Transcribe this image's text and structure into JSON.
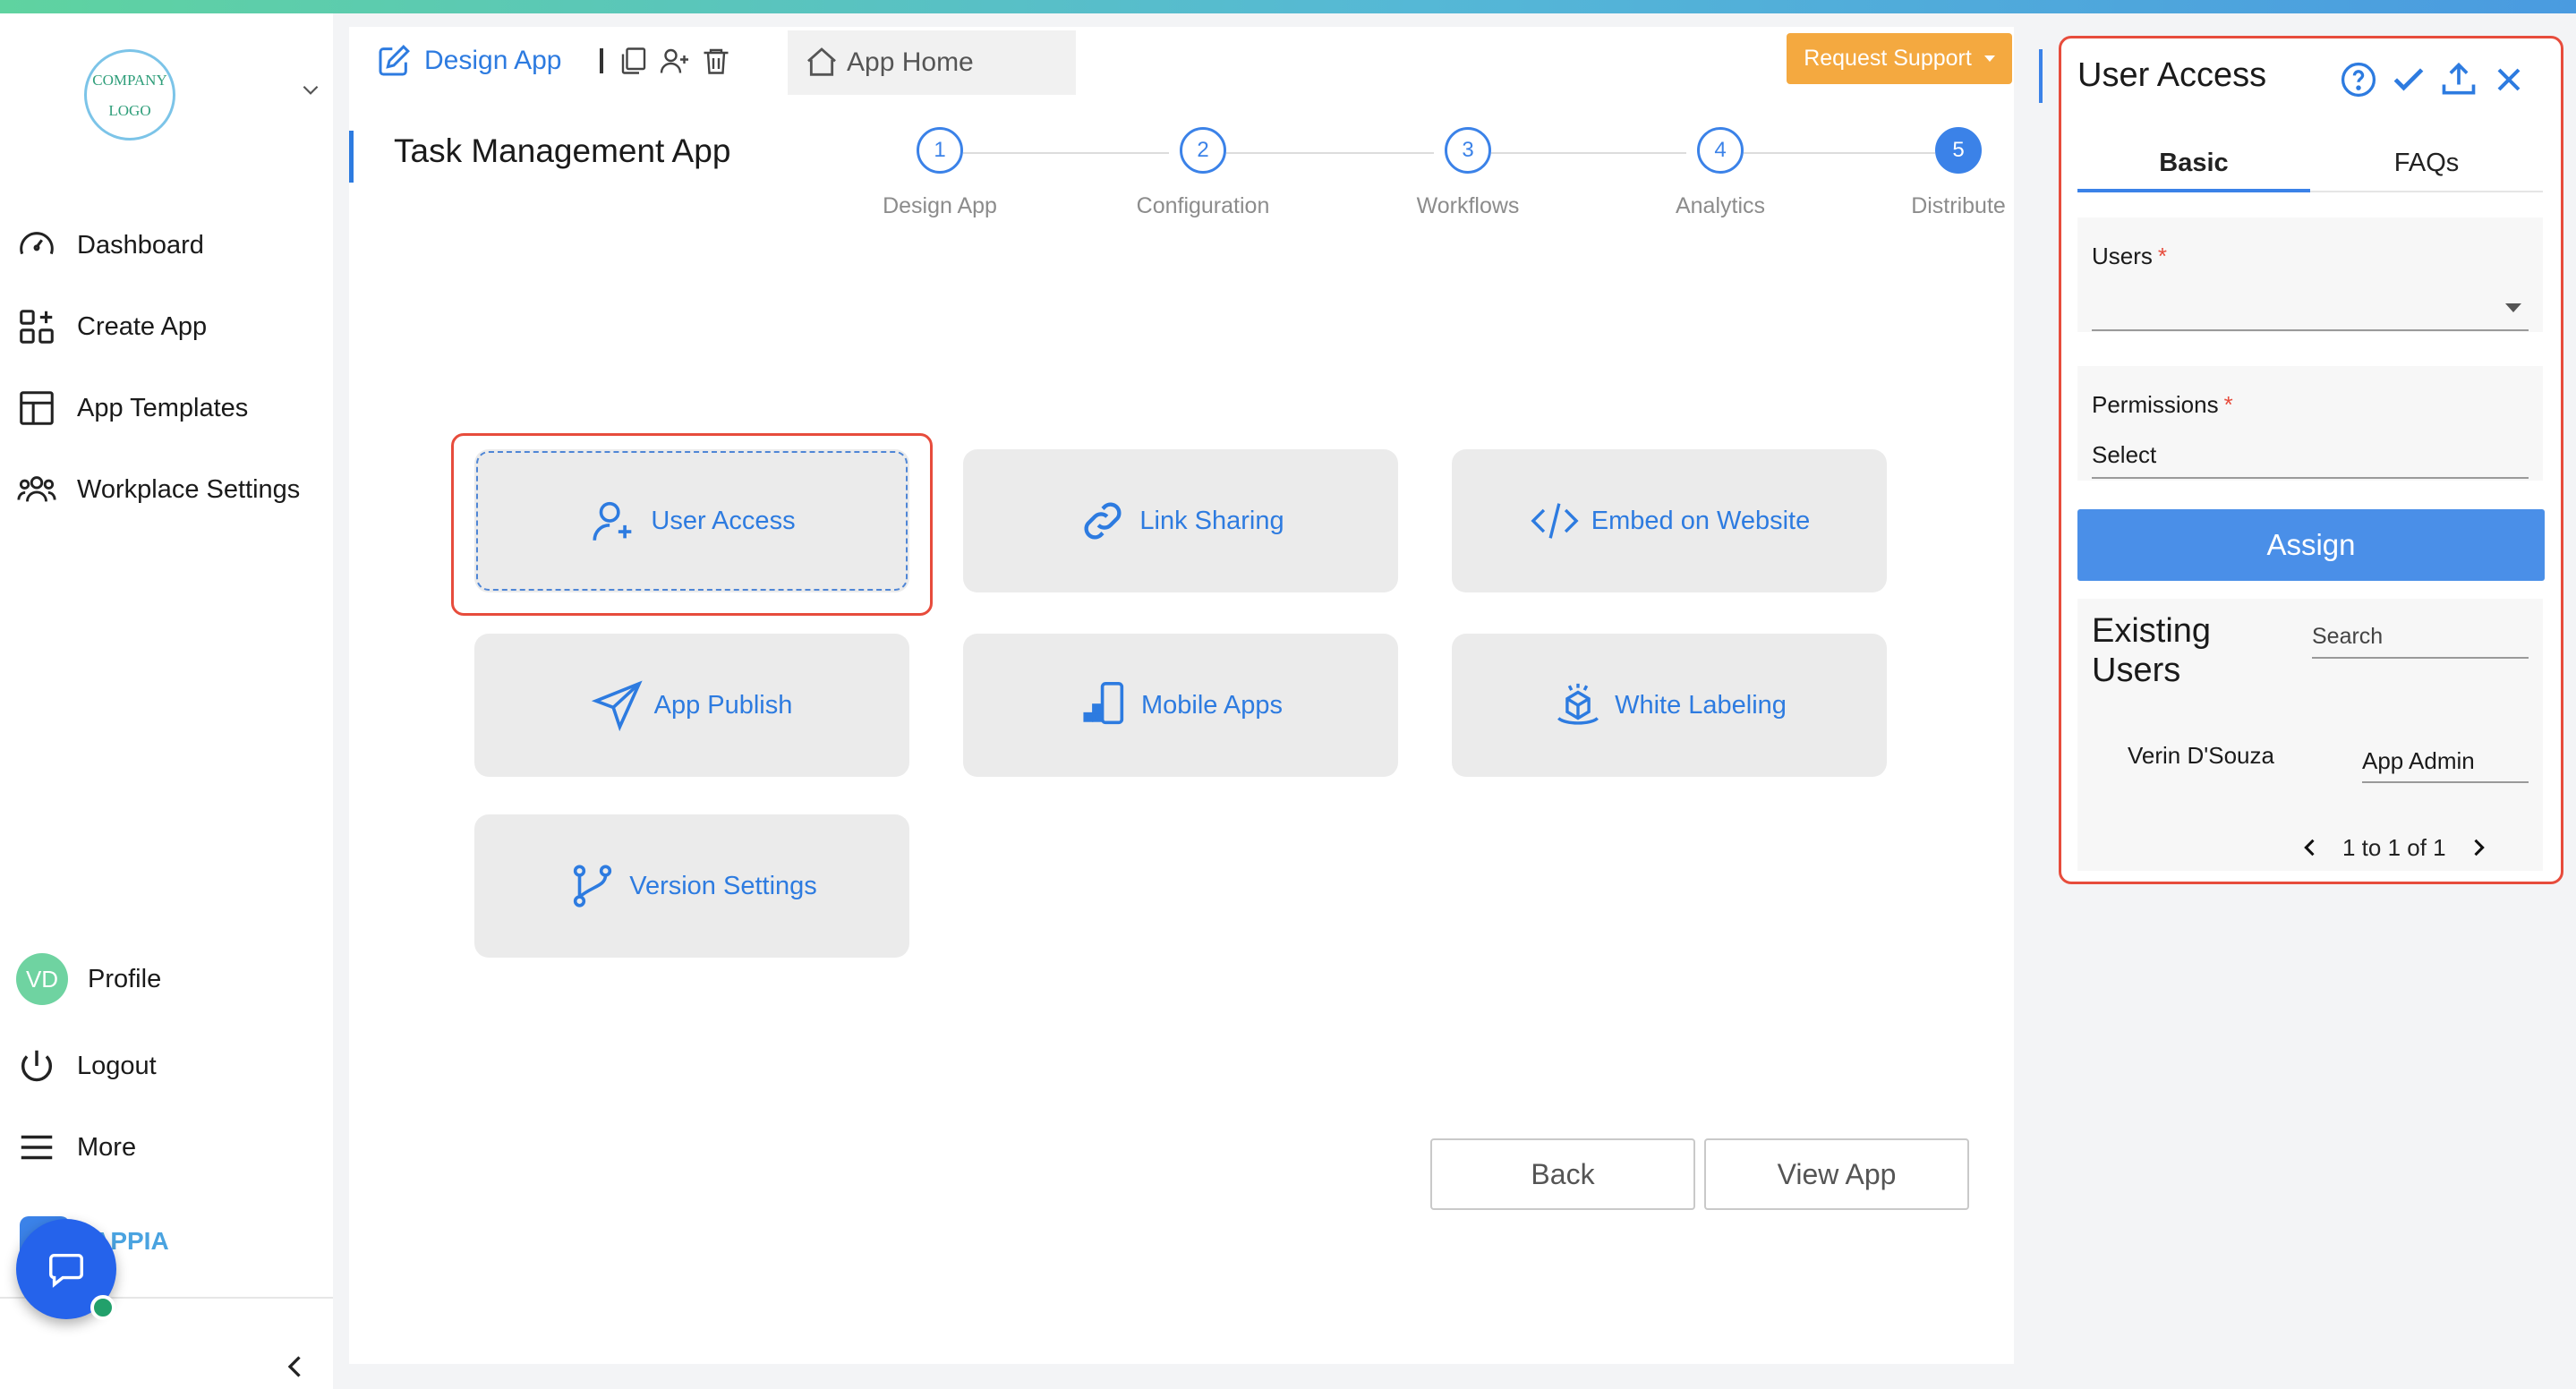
{
  "logo": {
    "line1": "COMPANY",
    "line2": "LOGO"
  },
  "sidebar": {
    "items": [
      {
        "label": "Dashboard",
        "icon": "gauge-icon"
      },
      {
        "label": "Create App",
        "icon": "grid-plus-icon"
      },
      {
        "label": "App Templates",
        "icon": "layout-icon"
      },
      {
        "label": "Workplace Settings",
        "icon": "users-group-icon"
      }
    ],
    "profile": {
      "initials": "VD",
      "label": "Profile"
    },
    "logout_label": "Logout",
    "more_label": "More",
    "brand_text": "LAPPIA"
  },
  "header": {
    "design_tab_label": "Design App",
    "home_tab_label": "App Home",
    "support_label": "Request Support"
  },
  "app_title": "Task Management App",
  "steps": [
    {
      "num": "1",
      "label": "Design App"
    },
    {
      "num": "2",
      "label": "Configuration"
    },
    {
      "num": "3",
      "label": "Workflows"
    },
    {
      "num": "4",
      "label": "Analytics"
    },
    {
      "num": "5",
      "label": "Distribute",
      "active": true
    }
  ],
  "cards": [
    {
      "label": "User Access",
      "icon": "user-plus-icon"
    },
    {
      "label": "Link Sharing",
      "icon": "link-icon"
    },
    {
      "label": "Embed on Website",
      "icon": "code-icon"
    },
    {
      "label": "App Publish",
      "icon": "send-icon"
    },
    {
      "label": "Mobile Apps",
      "icon": "mobile-icon"
    },
    {
      "label": "White Labeling",
      "icon": "box-icon"
    },
    {
      "label": "Version Settings",
      "icon": "git-branch-icon"
    }
  ],
  "footer": {
    "back_label": "Back",
    "view_label": "View App"
  },
  "panel": {
    "title": "User Access",
    "tabs": [
      "Basic",
      "FAQs"
    ],
    "users_label": "Users",
    "required_mark": "*",
    "users_value": "",
    "permissions_label": "Permissions",
    "permissions_value": "Select",
    "assign_label": "Assign",
    "existing_title": "Existing Users",
    "search_placeholder": "Search",
    "existing_users": [
      {
        "name": "Verin D'Souza",
        "role": "App Admin"
      }
    ],
    "pagination_text": "1 to 1 of 1"
  },
  "colors": {
    "accent": "#3b82e8",
    "support": "#f4a940",
    "highlight": "#e74c3c",
    "avatar": "#6fd3a1"
  }
}
